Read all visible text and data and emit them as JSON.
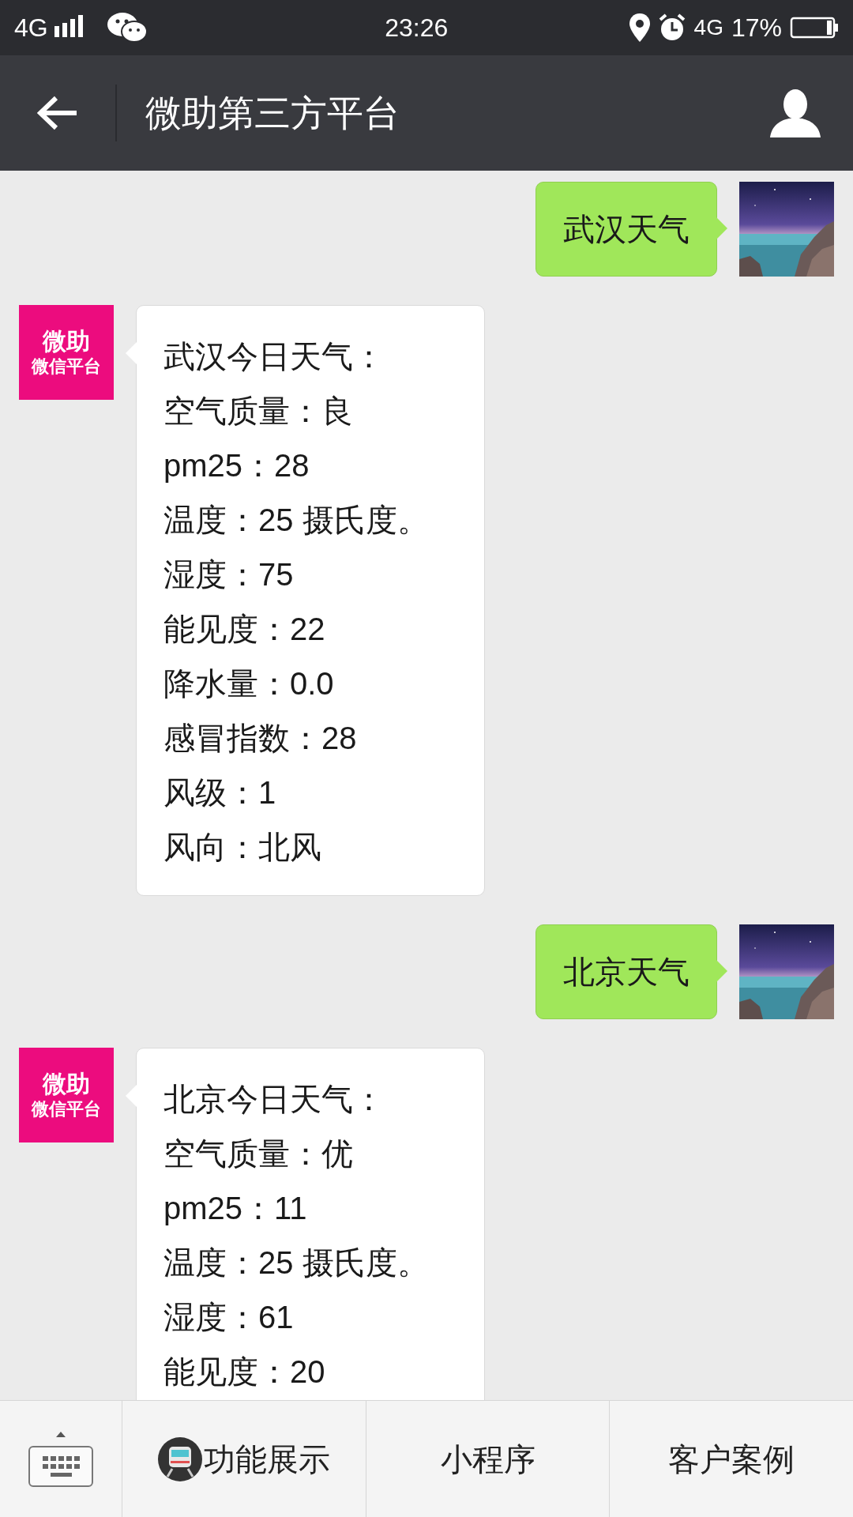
{
  "status_bar": {
    "network": "4G",
    "time": "23:26",
    "data": "4G",
    "battery": "17%"
  },
  "header": {
    "title": "微助第三方平台"
  },
  "messages": [
    {
      "kind": "sent",
      "text": "武汉天气"
    },
    {
      "kind": "received",
      "avatar": {
        "line_1": "微助",
        "line_2": "微信平台"
      },
      "lines": [
        "武汉今日天气：",
        "空气质量：良",
        "pm25：28",
        "温度：25 摄氏度。",
        "湿度：75",
        "能见度：22",
        "降水量：0.0",
        "感冒指数：28",
        "风级：1",
        "风向：北风"
      ]
    },
    {
      "kind": "sent",
      "text": "北京天气"
    },
    {
      "kind": "received",
      "avatar": {
        "line_1": "微助",
        "line_2": "微信平台"
      },
      "lines": [
        "北京今日天气：",
        "空气质量：优",
        "pm25：11",
        "温度：25 摄氏度。",
        "湿度：61",
        "能见度：20"
      ]
    }
  ],
  "menu": [
    {
      "label": "功能展示",
      "has_icon": true
    },
    {
      "label": "小程序",
      "has_icon": false
    },
    {
      "label": "客户案例",
      "has_icon": false
    }
  ]
}
